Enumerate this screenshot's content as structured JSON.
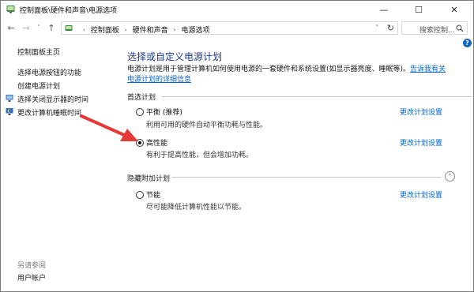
{
  "window": {
    "title": "控制面板\\硬件和声音\\电源选项",
    "min_glyph": "—",
    "max_glyph": "☐",
    "close_glyph": "✕"
  },
  "nav": {
    "back_glyph": "←",
    "forward_glyph": "→",
    "history_glyph": "˅",
    "up_glyph": "↑",
    "crumb_sep": "›",
    "breadcrumbs": [
      "控制面板",
      "硬件和声音",
      "电源选项"
    ],
    "dropdown_glyph": "˅",
    "refresh_glyph": "↻",
    "search_placeholder": "搜索控制..."
  },
  "help_glyph": "?",
  "sidebar": {
    "home": "控制面板主页",
    "items": [
      "选择电源按钮的功能",
      "创建电源计划",
      "选择关闭显示器的时间",
      "更改计算机睡眠时间"
    ],
    "see_also": "另请参阅",
    "user_accounts": "用户帐户"
  },
  "main": {
    "title": "选择或自定义电源计划",
    "description": "电源计划是用于管理计算机如何使用电源的一套硬件和系统设置(如显示器亮度、睡眠等)。",
    "description_link": "告诉我有关电源计划的详细信息",
    "preferred_label": "首选计划",
    "hidden_label": "隐藏附加计划",
    "collapse_glyph": "⌃",
    "plans": [
      {
        "name": "平衡 (推荐)",
        "desc": "利用可用的硬件自动平衡功耗与性能。",
        "link": "更改计划设置",
        "selected": false
      },
      {
        "name": "高性能",
        "desc": "有利于提高性能，但会增加功耗。",
        "link": "更改计划设置",
        "selected": true
      },
      {
        "name": "节能",
        "desc": "尽可能降低计算机性能以节能。",
        "link": "更改计划设置",
        "selected": false
      }
    ]
  },
  "colors": {
    "title_blue": "#1e3a8a",
    "link_blue": "#0066cc",
    "annotation_red": "#e53935"
  }
}
